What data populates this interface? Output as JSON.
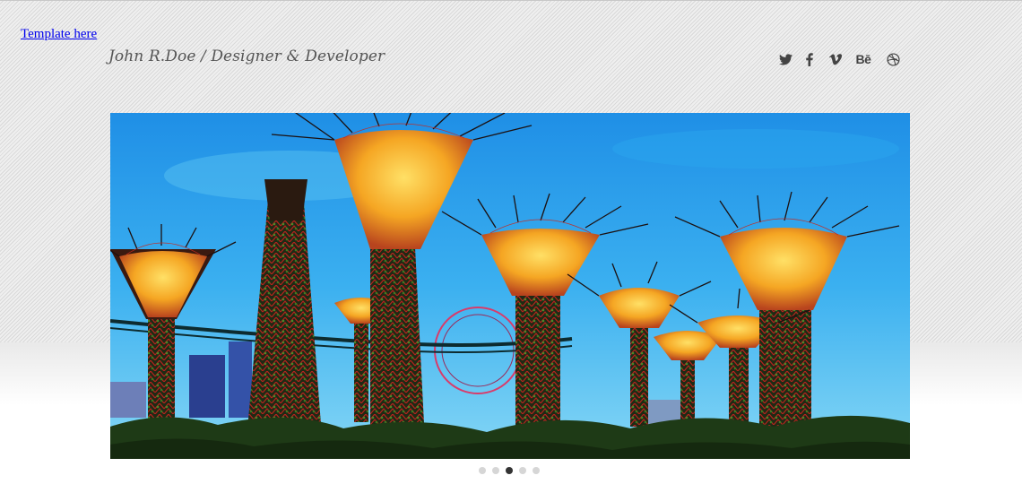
{
  "header": {
    "link_label": "Template here",
    "site_title": "John R.Doe / Designer & Developer"
  },
  "social": [
    {
      "name": "twitter",
      "icon": "twitter-icon"
    },
    {
      "name": "facebook",
      "icon": "facebook-icon"
    },
    {
      "name": "vimeo",
      "icon": "vimeo-icon"
    },
    {
      "name": "behance",
      "icon": "behance-icon",
      "glyph": "Bē"
    },
    {
      "name": "dribbble",
      "icon": "dribbble-icon"
    }
  ],
  "slider": {
    "image_subject": "supertree-grove-photo",
    "slide_count": 5,
    "active_index": 2
  },
  "colors": {
    "link": "#0000ee",
    "title_text": "#555555",
    "icon": "#444444",
    "dot": "#d6d6d6",
    "dot_active": "#333333"
  }
}
